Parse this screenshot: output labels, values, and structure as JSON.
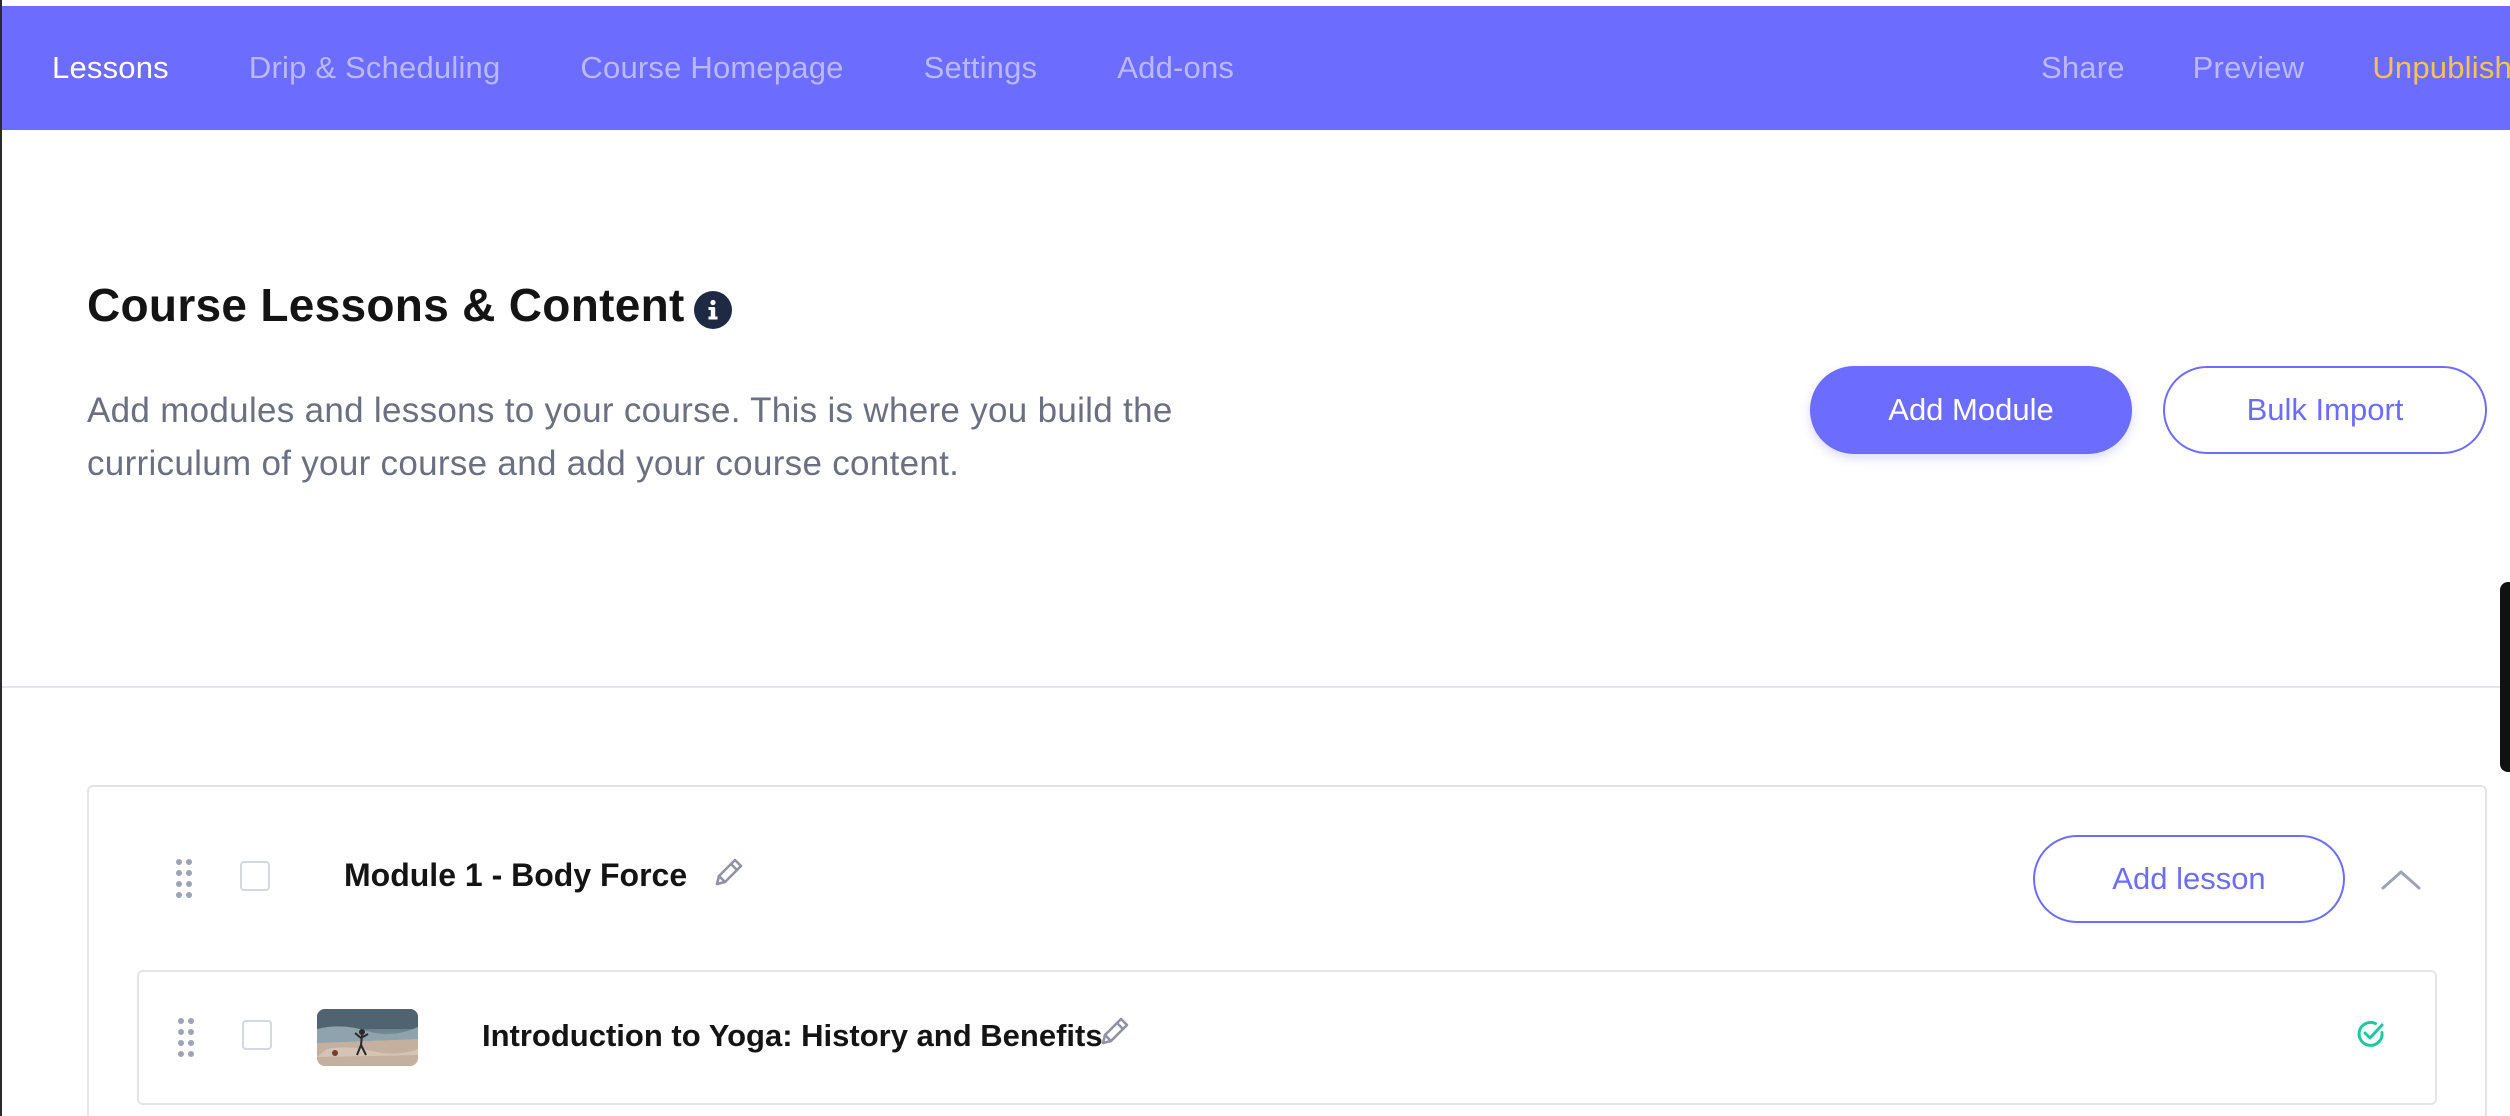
{
  "nav": {
    "left_items": [
      {
        "label": "Lessons",
        "active": true
      },
      {
        "label": "Drip & Scheduling",
        "active": false
      },
      {
        "label": "Course Homepage",
        "active": false
      },
      {
        "label": "Settings",
        "active": false
      },
      {
        "label": "Add-ons",
        "active": false
      }
    ],
    "right_items": [
      {
        "label": "Share"
      },
      {
        "label": "Preview"
      },
      {
        "label": "Unpublish"
      }
    ],
    "accent_color": "#6c6cff",
    "unpublish_color": "#f5c44f"
  },
  "header": {
    "title": "Course Lessons & Content",
    "info_icon": "info-icon",
    "description": "Add modules and lessons to your course. This is where you build the curriculum of your course and add your course content.",
    "add_module_label": "Add Module",
    "bulk_import_label": "Bulk Import"
  },
  "module": {
    "title": "Module 1 - Body Force",
    "add_lesson_label": "Add lesson",
    "lessons": [
      {
        "title": "Introduction to Yoga: History and Benefits",
        "status_icon": "check-circle-icon",
        "status_color": "#1fc9a0"
      }
    ]
  }
}
